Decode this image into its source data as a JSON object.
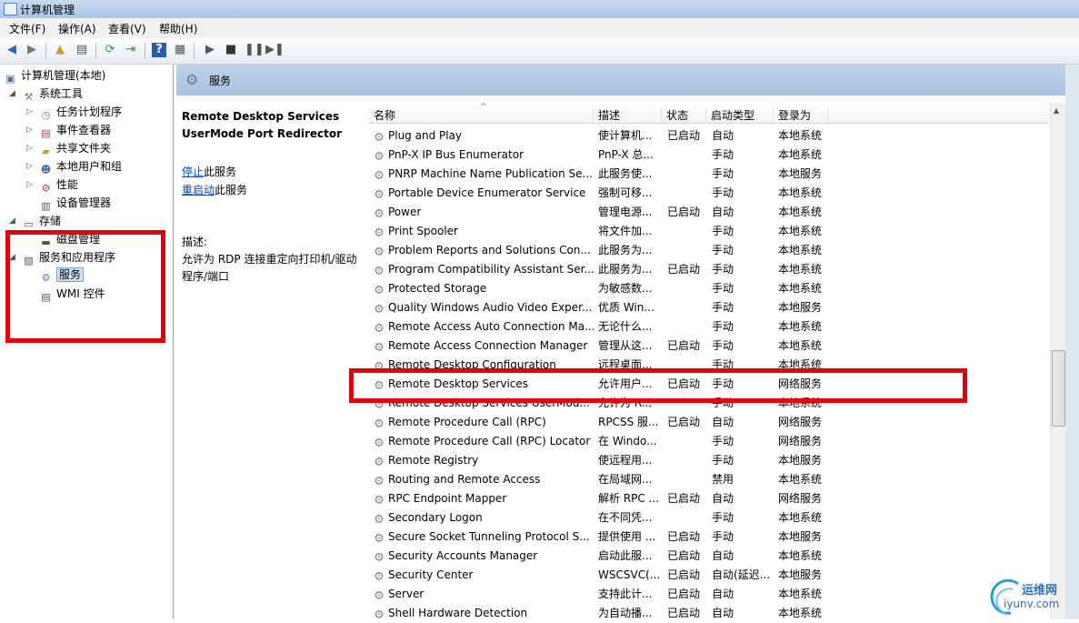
{
  "window": {
    "title": "计算机管理"
  },
  "menu": [
    "文件(F)",
    "操作(A)",
    "查看(V)",
    "帮助(H)"
  ],
  "tree": {
    "root": "计算机管理(本地)",
    "system_tools": "系统工具",
    "items": [
      "任务计划程序",
      "事件查看器",
      "共享文件夹",
      "本地用户和组",
      "性能",
      "设备管理器"
    ],
    "storage": "存储",
    "disk_mgmt": "磁盘管理",
    "services_apps": "服务和应用程序",
    "services": "服务",
    "wmi": "WMI 控件"
  },
  "pane_title": "服务",
  "detail": {
    "service_name_line1": "Remote Desktop Services",
    "service_name_line2": "UserMode Port Redirector",
    "stop_link": "停止",
    "stop_suffix": "此服务",
    "restart_link": "重启动",
    "restart_suffix": "此服务",
    "desc_label": "描述:",
    "desc_text": "允许为 RDP 连接重定向打印机/驱动程序/端口"
  },
  "columns": {
    "name": "名称",
    "desc": "描述",
    "status": "状态",
    "startup": "启动类型",
    "logon": "登录为"
  },
  "rows": [
    {
      "name": "Plug and Play",
      "desc": "使计算机...",
      "status": "已启动",
      "startup": "自动",
      "logon": "本地系统"
    },
    {
      "name": "PnP-X IP Bus Enumerator",
      "desc": "PnP-X 总...",
      "status": "",
      "startup": "手动",
      "logon": "本地系统"
    },
    {
      "name": "PNRP Machine Name Publication Se...",
      "desc": "此服务使...",
      "status": "",
      "startup": "手动",
      "logon": "本地服务"
    },
    {
      "name": "Portable Device Enumerator Service",
      "desc": "强制可移...",
      "status": "",
      "startup": "手动",
      "logon": "本地系统"
    },
    {
      "name": "Power",
      "desc": "管理电源...",
      "status": "已启动",
      "startup": "自动",
      "logon": "本地系统"
    },
    {
      "name": "Print Spooler",
      "desc": "将文件加...",
      "status": "",
      "startup": "手动",
      "logon": "本地系统"
    },
    {
      "name": "Problem Reports and Solutions Con...",
      "desc": "此服务为...",
      "status": "",
      "startup": "手动",
      "logon": "本地系统"
    },
    {
      "name": "Program Compatibility Assistant Ser...",
      "desc": "此服务为...",
      "status": "已启动",
      "startup": "手动",
      "logon": "本地系统"
    },
    {
      "name": "Protected Storage",
      "desc": "为敏感数...",
      "status": "",
      "startup": "手动",
      "logon": "本地系统"
    },
    {
      "name": "Quality Windows Audio Video Exper...",
      "desc": "优质 Win...",
      "status": "",
      "startup": "手动",
      "logon": "本地服务"
    },
    {
      "name": "Remote Access Auto Connection Ma...",
      "desc": "无论什么...",
      "status": "",
      "startup": "手动",
      "logon": "本地系统"
    },
    {
      "name": "Remote Access Connection Manager",
      "desc": "管理从这...",
      "status": "已启动",
      "startup": "手动",
      "logon": "本地系统"
    },
    {
      "name": "Remote Desktop Configuration",
      "desc": "远程桌面...",
      "status": "",
      "startup": "手动",
      "logon": "本地系统"
    },
    {
      "name": "Remote Desktop Services",
      "desc": "允许用户...",
      "status": "已启动",
      "startup": "手动",
      "logon": "网络服务"
    },
    {
      "name": "Remote Desktop Services UserMod...",
      "desc": "允许为 R...",
      "status": "",
      "startup": "手动",
      "logon": "本地系统"
    },
    {
      "name": "Remote Procedure Call (RPC)",
      "desc": "RPCSS 服...",
      "status": "已启动",
      "startup": "自动",
      "logon": "网络服务"
    },
    {
      "name": "Remote Procedure Call (RPC) Locator",
      "desc": "在 Windo...",
      "status": "",
      "startup": "手动",
      "logon": "网络服务"
    },
    {
      "name": "Remote Registry",
      "desc": "使远程用...",
      "status": "",
      "startup": "手动",
      "logon": "本地服务"
    },
    {
      "name": "Routing and Remote Access",
      "desc": "在局域网...",
      "status": "",
      "startup": "禁用",
      "logon": "本地系统"
    },
    {
      "name": "RPC Endpoint Mapper",
      "desc": "解析 RPC ...",
      "status": "已启动",
      "startup": "自动",
      "logon": "网络服务"
    },
    {
      "name": "Secondary Logon",
      "desc": "在不同凭...",
      "status": "",
      "startup": "手动",
      "logon": "本地系统"
    },
    {
      "name": "Secure Socket Tunneling Protocol S...",
      "desc": "提供使用 ...",
      "status": "已启动",
      "startup": "手动",
      "logon": "本地服务"
    },
    {
      "name": "Security Accounts Manager",
      "desc": "启动此服...",
      "status": "已启动",
      "startup": "自动",
      "logon": "本地系统"
    },
    {
      "name": "Security Center",
      "desc": "WSCSVC(...",
      "status": "已启动",
      "startup": "自动(延迟...",
      "logon": "本地服务"
    },
    {
      "name": "Server",
      "desc": "支持此计...",
      "status": "已启动",
      "startup": "自动",
      "logon": "本地系统"
    },
    {
      "name": "Shell Hardware Detection",
      "desc": "为自动播...",
      "status": "已启动",
      "startup": "自动",
      "logon": "本地系统"
    }
  ],
  "watermark": {
    "line1": "运维网",
    "line2": "iyunv.com"
  },
  "colors": {
    "highlight_red": "#e0000d",
    "link_blue": "#0645ad",
    "header_blue": "#bed3e9"
  }
}
